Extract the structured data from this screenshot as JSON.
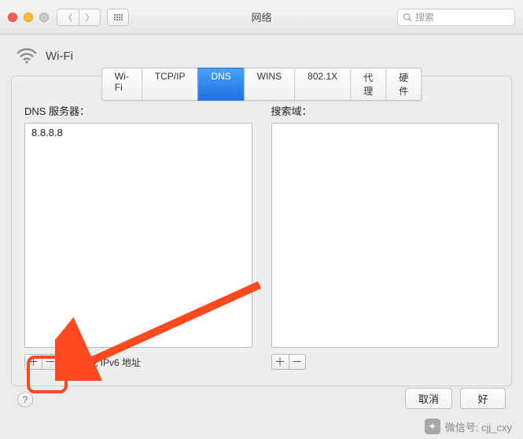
{
  "window": {
    "title": "网络"
  },
  "search": {
    "placeholder": "搜索"
  },
  "interface": {
    "name": "Wi-Fi"
  },
  "tabs": [
    {
      "id": "wifi",
      "label": "Wi-Fi",
      "active": false
    },
    {
      "id": "tcpip",
      "label": "TCP/IP",
      "active": false
    },
    {
      "id": "dns",
      "label": "DNS",
      "active": true
    },
    {
      "id": "wins",
      "label": "WINS",
      "active": false
    },
    {
      "id": "8021x",
      "label": "802.1X",
      "active": false
    },
    {
      "id": "proxy",
      "label": "代理",
      "active": false
    },
    {
      "id": "hardware",
      "label": "硬件",
      "active": false
    }
  ],
  "dns": {
    "servers_label": "DNS 服务器：",
    "servers": [
      "8.8.8.8"
    ],
    "hint": "IPv4 或 IPv6 地址",
    "search_domains_label": "搜索域：",
    "search_domains": []
  },
  "buttons": {
    "cancel": "取消",
    "ok": "好",
    "plus": "＋",
    "minus": "－",
    "help": "?"
  },
  "watermark": {
    "text": "微信号: cjj_cxy"
  },
  "colors": {
    "accent": "#2f82e8",
    "highlight": "#ff4a1f"
  }
}
